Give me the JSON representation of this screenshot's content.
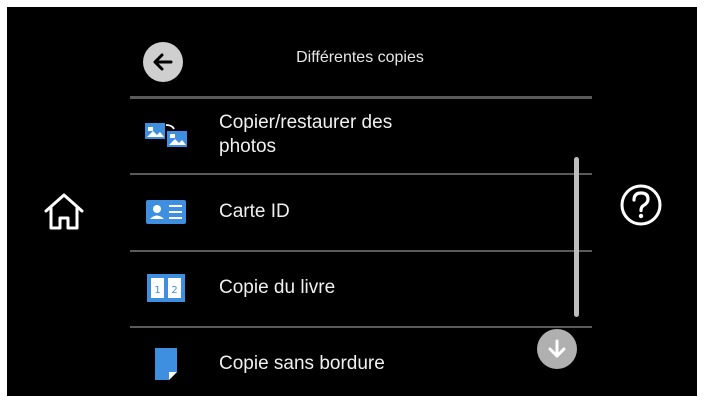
{
  "header": {
    "title": "Différentes copies"
  },
  "menu": {
    "items": [
      {
        "label_line1": "Copier/restaurer des",
        "label_line2": "photos",
        "icon": "photo-restore-icon"
      },
      {
        "label": "Carte ID",
        "icon": "id-card-icon"
      },
      {
        "label": "Copie du livre",
        "icon": "book-copy-icon"
      },
      {
        "label": "Copie sans bordure",
        "icon": "borderless-page-icon"
      }
    ]
  },
  "nav": {
    "back_icon": "arrow-left-icon",
    "home_icon": "home-icon",
    "help_icon": "help-icon",
    "down_icon": "arrow-down-icon"
  },
  "colors": {
    "background": "#000000",
    "icon_blue": "#3f8fe0",
    "button_gray": "#cfcfcf",
    "separator": "#5a5a5a"
  }
}
